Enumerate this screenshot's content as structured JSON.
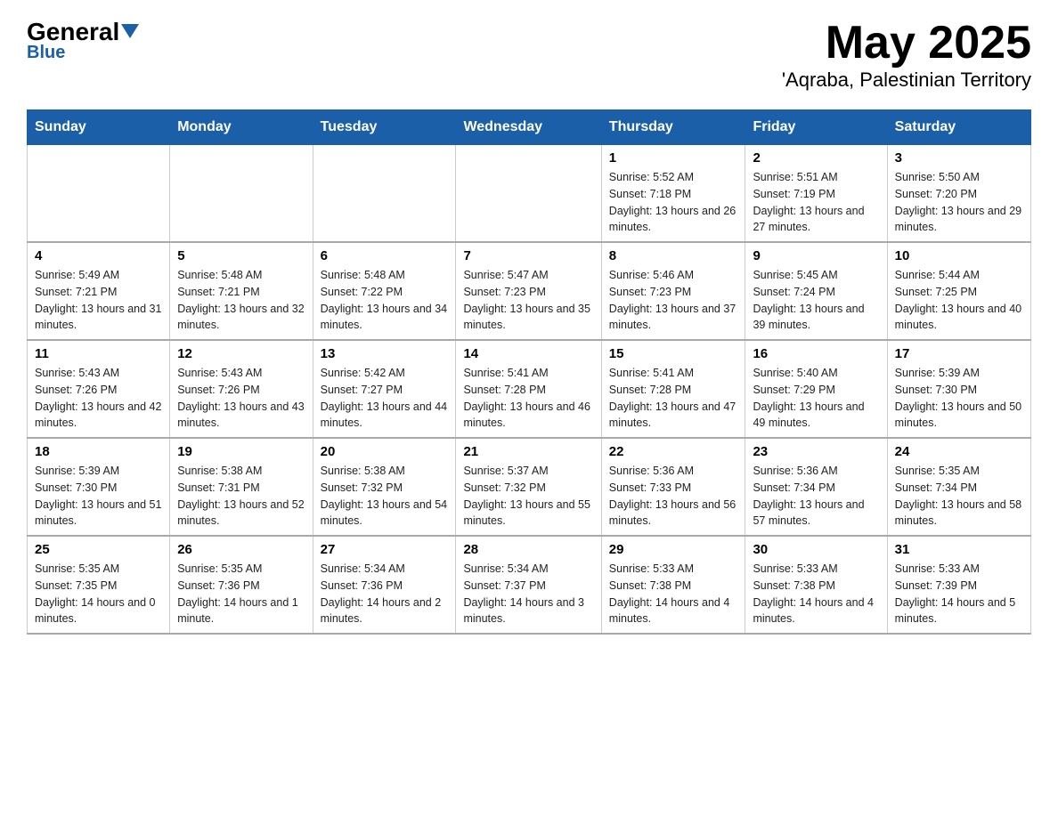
{
  "header": {
    "logo_general": "General",
    "logo_blue": "Blue",
    "title": "May 2025",
    "subtitle": "'Aqraba, Palestinian Territory"
  },
  "days_of_week": [
    "Sunday",
    "Monday",
    "Tuesday",
    "Wednesday",
    "Thursday",
    "Friday",
    "Saturday"
  ],
  "weeks": [
    [
      {
        "day": "",
        "info": ""
      },
      {
        "day": "",
        "info": ""
      },
      {
        "day": "",
        "info": ""
      },
      {
        "day": "",
        "info": ""
      },
      {
        "day": "1",
        "info": "Sunrise: 5:52 AM\nSunset: 7:18 PM\nDaylight: 13 hours and 26 minutes."
      },
      {
        "day": "2",
        "info": "Sunrise: 5:51 AM\nSunset: 7:19 PM\nDaylight: 13 hours and 27 minutes."
      },
      {
        "day": "3",
        "info": "Sunrise: 5:50 AM\nSunset: 7:20 PM\nDaylight: 13 hours and 29 minutes."
      }
    ],
    [
      {
        "day": "4",
        "info": "Sunrise: 5:49 AM\nSunset: 7:21 PM\nDaylight: 13 hours and 31 minutes."
      },
      {
        "day": "5",
        "info": "Sunrise: 5:48 AM\nSunset: 7:21 PM\nDaylight: 13 hours and 32 minutes."
      },
      {
        "day": "6",
        "info": "Sunrise: 5:48 AM\nSunset: 7:22 PM\nDaylight: 13 hours and 34 minutes."
      },
      {
        "day": "7",
        "info": "Sunrise: 5:47 AM\nSunset: 7:23 PM\nDaylight: 13 hours and 35 minutes."
      },
      {
        "day": "8",
        "info": "Sunrise: 5:46 AM\nSunset: 7:23 PM\nDaylight: 13 hours and 37 minutes."
      },
      {
        "day": "9",
        "info": "Sunrise: 5:45 AM\nSunset: 7:24 PM\nDaylight: 13 hours and 39 minutes."
      },
      {
        "day": "10",
        "info": "Sunrise: 5:44 AM\nSunset: 7:25 PM\nDaylight: 13 hours and 40 minutes."
      }
    ],
    [
      {
        "day": "11",
        "info": "Sunrise: 5:43 AM\nSunset: 7:26 PM\nDaylight: 13 hours and 42 minutes."
      },
      {
        "day": "12",
        "info": "Sunrise: 5:43 AM\nSunset: 7:26 PM\nDaylight: 13 hours and 43 minutes."
      },
      {
        "day": "13",
        "info": "Sunrise: 5:42 AM\nSunset: 7:27 PM\nDaylight: 13 hours and 44 minutes."
      },
      {
        "day": "14",
        "info": "Sunrise: 5:41 AM\nSunset: 7:28 PM\nDaylight: 13 hours and 46 minutes."
      },
      {
        "day": "15",
        "info": "Sunrise: 5:41 AM\nSunset: 7:28 PM\nDaylight: 13 hours and 47 minutes."
      },
      {
        "day": "16",
        "info": "Sunrise: 5:40 AM\nSunset: 7:29 PM\nDaylight: 13 hours and 49 minutes."
      },
      {
        "day": "17",
        "info": "Sunrise: 5:39 AM\nSunset: 7:30 PM\nDaylight: 13 hours and 50 minutes."
      }
    ],
    [
      {
        "day": "18",
        "info": "Sunrise: 5:39 AM\nSunset: 7:30 PM\nDaylight: 13 hours and 51 minutes."
      },
      {
        "day": "19",
        "info": "Sunrise: 5:38 AM\nSunset: 7:31 PM\nDaylight: 13 hours and 52 minutes."
      },
      {
        "day": "20",
        "info": "Sunrise: 5:38 AM\nSunset: 7:32 PM\nDaylight: 13 hours and 54 minutes."
      },
      {
        "day": "21",
        "info": "Sunrise: 5:37 AM\nSunset: 7:32 PM\nDaylight: 13 hours and 55 minutes."
      },
      {
        "day": "22",
        "info": "Sunrise: 5:36 AM\nSunset: 7:33 PM\nDaylight: 13 hours and 56 minutes."
      },
      {
        "day": "23",
        "info": "Sunrise: 5:36 AM\nSunset: 7:34 PM\nDaylight: 13 hours and 57 minutes."
      },
      {
        "day": "24",
        "info": "Sunrise: 5:35 AM\nSunset: 7:34 PM\nDaylight: 13 hours and 58 minutes."
      }
    ],
    [
      {
        "day": "25",
        "info": "Sunrise: 5:35 AM\nSunset: 7:35 PM\nDaylight: 14 hours and 0 minutes."
      },
      {
        "day": "26",
        "info": "Sunrise: 5:35 AM\nSunset: 7:36 PM\nDaylight: 14 hours and 1 minute."
      },
      {
        "day": "27",
        "info": "Sunrise: 5:34 AM\nSunset: 7:36 PM\nDaylight: 14 hours and 2 minutes."
      },
      {
        "day": "28",
        "info": "Sunrise: 5:34 AM\nSunset: 7:37 PM\nDaylight: 14 hours and 3 minutes."
      },
      {
        "day": "29",
        "info": "Sunrise: 5:33 AM\nSunset: 7:38 PM\nDaylight: 14 hours and 4 minutes."
      },
      {
        "day": "30",
        "info": "Sunrise: 5:33 AM\nSunset: 7:38 PM\nDaylight: 14 hours and 4 minutes."
      },
      {
        "day": "31",
        "info": "Sunrise: 5:33 AM\nSunset: 7:39 PM\nDaylight: 14 hours and 5 minutes."
      }
    ]
  ]
}
